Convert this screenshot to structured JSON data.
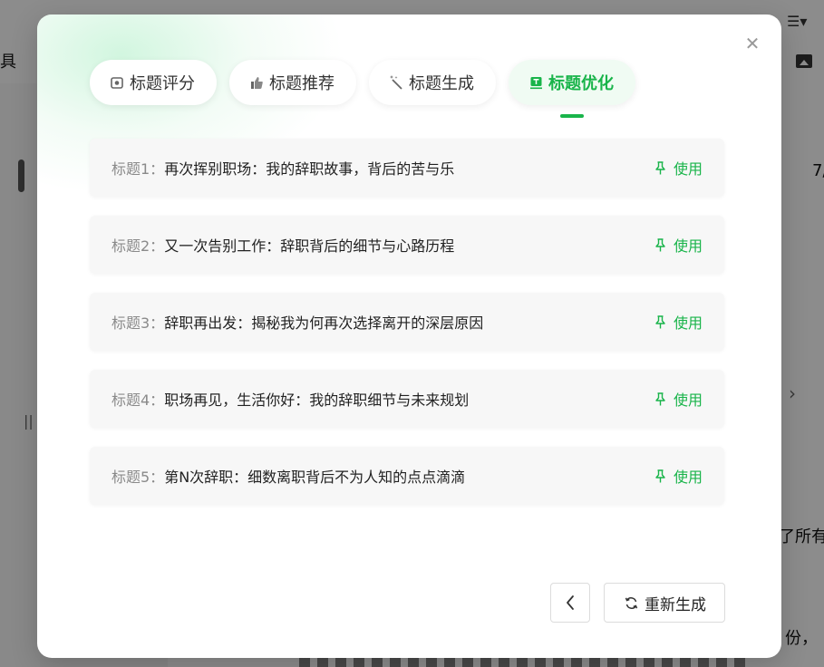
{
  "background": {
    "toolbar_fragment": "具",
    "right_fragment_1": "7/",
    "right_fragment_2": "了所有",
    "right_fragment_3": "份，"
  },
  "modal": {
    "tabs": [
      {
        "label": "标题评分",
        "icon": "score-icon",
        "active": false
      },
      {
        "label": "标题推荐",
        "icon": "thumbs-up-icon",
        "active": false
      },
      {
        "label": "标题生成",
        "icon": "magic-wand-icon",
        "active": false
      },
      {
        "label": "标题优化",
        "icon": "optimize-icon",
        "active": true
      }
    ],
    "titles": [
      {
        "prefix": "标题1：",
        "text": "再次挥别职场：我的辞职故事，背后的苦与乐",
        "action": "使用"
      },
      {
        "prefix": "标题2：",
        "text": "又一次告别工作：辞职背后的细节与心路历程",
        "action": "使用"
      },
      {
        "prefix": "标题3：",
        "text": "辞职再出发：揭秘我为何再次选择离开的深层原因",
        "action": "使用"
      },
      {
        "prefix": "标题4：",
        "text": "职场再见，生活你好：我的辞职细节与未来规划",
        "action": "使用"
      },
      {
        "prefix": "标题5：",
        "text": "第N次辞职：细数离职背后不为人知的点点滴滴",
        "action": "使用"
      }
    ],
    "footer": {
      "regenerate_label": "重新生成"
    }
  },
  "colors": {
    "accent": "#19b44a",
    "active_tab_bg": "#f0fbf3",
    "row_bg": "#f7f7f7"
  }
}
